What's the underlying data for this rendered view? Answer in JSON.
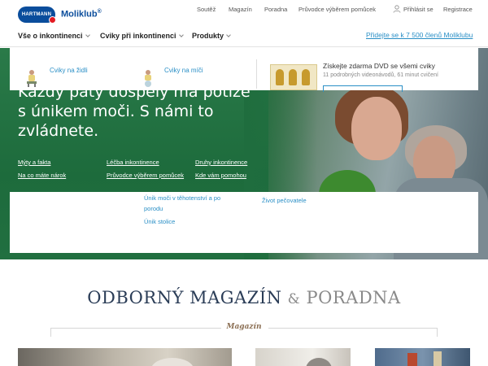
{
  "header": {
    "logo_text": "HARTMANN",
    "brand": "Moliklub",
    "brand_mark": "®",
    "topnav": [
      {
        "label": "Soutěž"
      },
      {
        "label": "Magazín"
      },
      {
        "label": "Poradna"
      },
      {
        "label": "Průvodce výběrem pomůcek"
      },
      {
        "label": "Přihlásit se"
      },
      {
        "label": "Registrace"
      }
    ],
    "mainnav": [
      {
        "label": "Vše o inkontinenci"
      },
      {
        "label": "Cviky při inkontinenci"
      },
      {
        "label": "Produkty"
      }
    ],
    "join_link": "Přidejte se k 7 500 členů Moliklubu"
  },
  "dropdown": {
    "exercises": [
      {
        "label": "Cviky na židli"
      },
      {
        "label": "Cviky na míči"
      }
    ],
    "dvd_title": "Získejte zdarma DVD se všemi cviky",
    "dvd_subtitle": "11 podrobných videonávodů, 61 minut cvičení",
    "links": [
      {
        "label": "Únik moči v těhotenství a po"
      },
      {
        "label": "porodu"
      },
      {
        "label": "Únik stolice"
      },
      {
        "label": "Život pečovatele"
      }
    ]
  },
  "hero": {
    "title_line1": "Každý pátý dospělý má potíže",
    "title_line2": "s únikem moči. S námi to",
    "title_line3": "zvládnete.",
    "links": [
      {
        "label": "Mýty a fakta"
      },
      {
        "label": "Léčba inkontinence"
      },
      {
        "label": "Druhy inkontinence"
      },
      {
        "label": "Na co máte nárok"
      },
      {
        "label": "Průvodce výběrem pomůcek"
      },
      {
        "label": "Kde vám pomohou"
      }
    ]
  },
  "magazine": {
    "title_main": "ODBORNÝ MAGAZÍN",
    "title_amp": "&",
    "title_second": "PORADNA",
    "subtitle": "Magazín"
  },
  "colors": {
    "brand_blue": "#0a4d9c",
    "link_blue": "#2a8fc6",
    "hero_green": "#1f6b3d",
    "magazine_navy": "#2b3d57",
    "magazine_brown": "#8b6f54"
  }
}
